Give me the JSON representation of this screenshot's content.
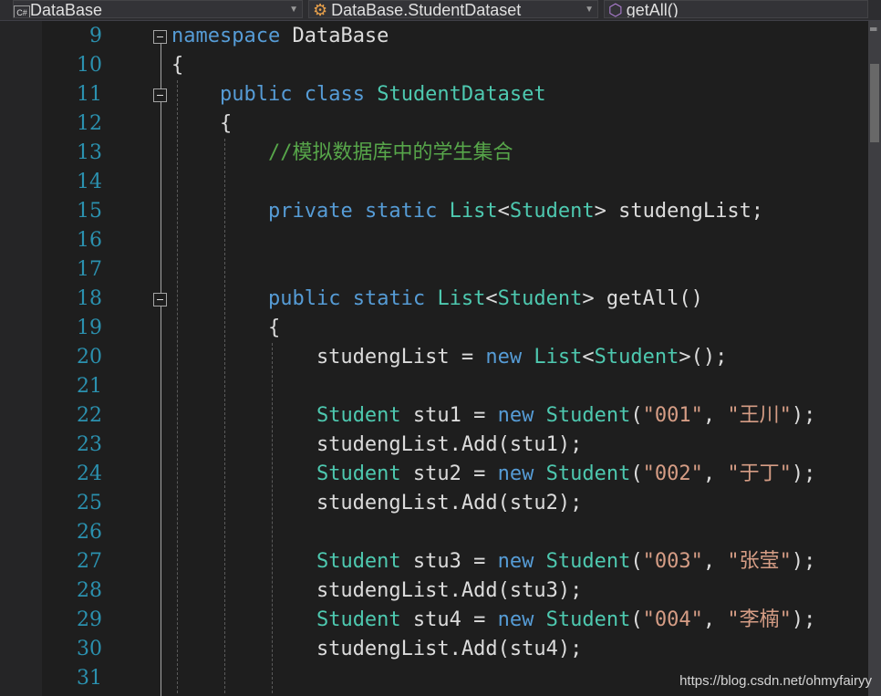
{
  "navbar": {
    "project": "DataBase",
    "project_icon": "csharp-project-icon",
    "type": "DataBase.StudentDataset",
    "type_icon": "class-icon",
    "member": "getAll()",
    "member_icon": "method-icon"
  },
  "colors": {
    "keyword": "#569cd6",
    "type": "#4ec9b0",
    "string": "#d69d85",
    "comment": "#57a64a",
    "line_number": "#2b91af",
    "text": "#dcdcdc"
  },
  "code": {
    "line_numbers": [
      "9",
      "10",
      "11",
      "12",
      "13",
      "14",
      "15",
      "16",
      "17",
      "18",
      "19",
      "20",
      "21",
      "22",
      "23",
      "24",
      "25",
      "26",
      "27",
      "28",
      "29",
      "30",
      "31"
    ],
    "lines": [
      [
        {
          "t": "kw",
          "v": "namespace"
        },
        {
          "t": "tx",
          "v": " DataBase"
        }
      ],
      [
        {
          "t": "tx",
          "v": "{"
        }
      ],
      [
        {
          "t": "tx",
          "v": "    "
        },
        {
          "t": "kw",
          "v": "public"
        },
        {
          "t": "tx",
          "v": " "
        },
        {
          "t": "kw",
          "v": "class"
        },
        {
          "t": "tx",
          "v": " "
        },
        {
          "t": "ty",
          "v": "StudentDataset"
        }
      ],
      [
        {
          "t": "tx",
          "v": "    {"
        }
      ],
      [
        {
          "t": "tx",
          "v": "        "
        },
        {
          "t": "cm",
          "v": "//模拟数据库中的学生集合"
        }
      ],
      [],
      [
        {
          "t": "tx",
          "v": "        "
        },
        {
          "t": "kw",
          "v": "private"
        },
        {
          "t": "tx",
          "v": " "
        },
        {
          "t": "kw",
          "v": "static"
        },
        {
          "t": "tx",
          "v": " "
        },
        {
          "t": "ty",
          "v": "List"
        },
        {
          "t": "tx",
          "v": "<"
        },
        {
          "t": "ty",
          "v": "Student"
        },
        {
          "t": "tx",
          "v": "> studengList;"
        }
      ],
      [],
      [],
      [
        {
          "t": "tx",
          "v": "        "
        },
        {
          "t": "kw",
          "v": "public"
        },
        {
          "t": "tx",
          "v": " "
        },
        {
          "t": "kw",
          "v": "static"
        },
        {
          "t": "tx",
          "v": " "
        },
        {
          "t": "ty",
          "v": "List"
        },
        {
          "t": "tx",
          "v": "<"
        },
        {
          "t": "ty",
          "v": "Student"
        },
        {
          "t": "tx",
          "v": "> getAll()"
        }
      ],
      [
        {
          "t": "tx",
          "v": "        {"
        }
      ],
      [
        {
          "t": "tx",
          "v": "            studengList = "
        },
        {
          "t": "kw",
          "v": "new"
        },
        {
          "t": "tx",
          "v": " "
        },
        {
          "t": "ty",
          "v": "List"
        },
        {
          "t": "tx",
          "v": "<"
        },
        {
          "t": "ty",
          "v": "Student"
        },
        {
          "t": "tx",
          "v": ">();"
        }
      ],
      [],
      [
        {
          "t": "tx",
          "v": "            "
        },
        {
          "t": "ty",
          "v": "Student"
        },
        {
          "t": "tx",
          "v": " stu1 = "
        },
        {
          "t": "kw",
          "v": "new"
        },
        {
          "t": "tx",
          "v": " "
        },
        {
          "t": "ty",
          "v": "Student"
        },
        {
          "t": "tx",
          "v": "("
        },
        {
          "t": "st",
          "v": "\"001\""
        },
        {
          "t": "tx",
          "v": ", "
        },
        {
          "t": "st",
          "v": "\"王川\""
        },
        {
          "t": "tx",
          "v": ");"
        }
      ],
      [
        {
          "t": "tx",
          "v": "            studengList.Add(stu1);"
        }
      ],
      [
        {
          "t": "tx",
          "v": "            "
        },
        {
          "t": "ty",
          "v": "Student"
        },
        {
          "t": "tx",
          "v": " stu2 = "
        },
        {
          "t": "kw",
          "v": "new"
        },
        {
          "t": "tx",
          "v": " "
        },
        {
          "t": "ty",
          "v": "Student"
        },
        {
          "t": "tx",
          "v": "("
        },
        {
          "t": "st",
          "v": "\"002\""
        },
        {
          "t": "tx",
          "v": ", "
        },
        {
          "t": "st",
          "v": "\"于丁\""
        },
        {
          "t": "tx",
          "v": ");"
        }
      ],
      [
        {
          "t": "tx",
          "v": "            studengList.Add(stu2);"
        }
      ],
      [],
      [
        {
          "t": "tx",
          "v": "            "
        },
        {
          "t": "ty",
          "v": "Student"
        },
        {
          "t": "tx",
          "v": " stu3 = "
        },
        {
          "t": "kw",
          "v": "new"
        },
        {
          "t": "tx",
          "v": " "
        },
        {
          "t": "ty",
          "v": "Student"
        },
        {
          "t": "tx",
          "v": "("
        },
        {
          "t": "st",
          "v": "\"003\""
        },
        {
          "t": "tx",
          "v": ", "
        },
        {
          "t": "st",
          "v": "\"张莹\""
        },
        {
          "t": "tx",
          "v": ");"
        }
      ],
      [
        {
          "t": "tx",
          "v": "            studengList.Add(stu3);"
        }
      ],
      [
        {
          "t": "tx",
          "v": "            "
        },
        {
          "t": "ty",
          "v": "Student"
        },
        {
          "t": "tx",
          "v": " stu4 = "
        },
        {
          "t": "kw",
          "v": "new"
        },
        {
          "t": "tx",
          "v": " "
        },
        {
          "t": "ty",
          "v": "Student"
        },
        {
          "t": "tx",
          "v": "("
        },
        {
          "t": "st",
          "v": "\"004\""
        },
        {
          "t": "tx",
          "v": ", "
        },
        {
          "t": "st",
          "v": "\"李楠\""
        },
        {
          "t": "tx",
          "v": ");"
        }
      ],
      [
        {
          "t": "tx",
          "v": "            studengList.Add(stu4);"
        }
      ],
      []
    ]
  },
  "watermark": "https://blog.csdn.net/ohmyfairyy"
}
